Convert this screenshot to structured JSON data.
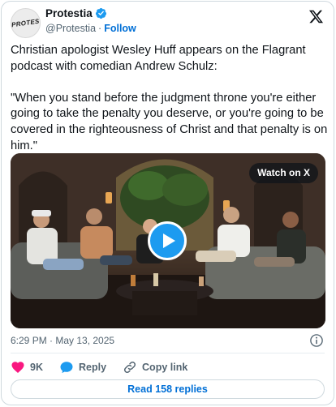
{
  "account": {
    "avatar_text": "PROTESTIA",
    "name": "Protestia",
    "handle": "@Protestia",
    "separator": "·",
    "follow_label": "Follow"
  },
  "post": {
    "text_line1": "Christian apologist Wesley Huff appears on the Flagrant podcast with comedian Andrew Schulz:",
    "text_quote": "\"When you stand before the judgment throne you're either going to take the penalty you deserve, or you're going to be covered in the righteousness of Christ and that penalty is on him.\""
  },
  "media": {
    "watch_label": "Watch on X"
  },
  "meta": {
    "timestamp": "6:29 PM · May 13, 2025"
  },
  "actions": {
    "like_count": "9K",
    "reply_label": "Reply",
    "copy_link_label": "Copy link"
  },
  "footer": {
    "read_replies_label": "Read 158 replies"
  },
  "colors": {
    "link_blue": "#006fd6",
    "verified_blue": "#1d9bf0",
    "heart_pink": "#f91880",
    "muted_text": "#536471"
  }
}
